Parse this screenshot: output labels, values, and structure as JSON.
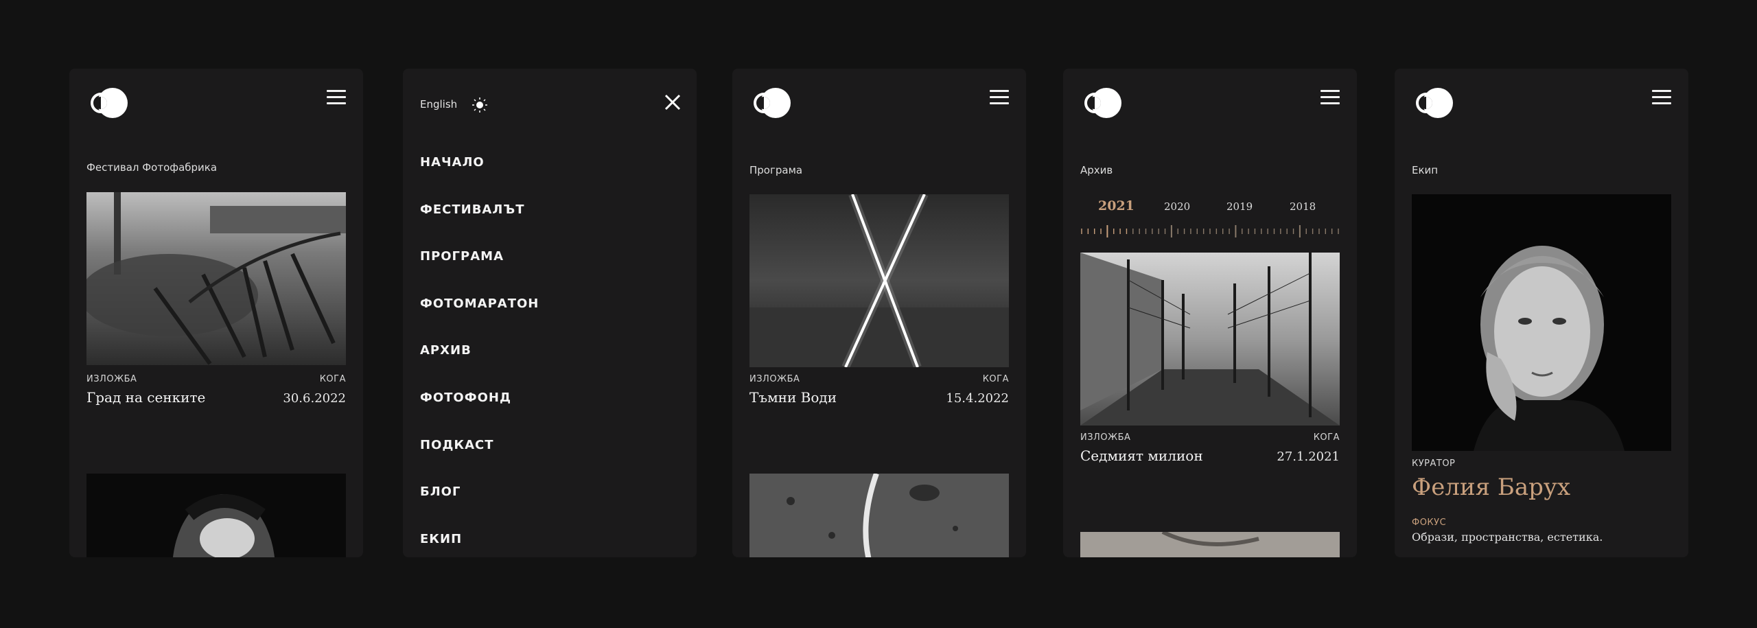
{
  "colors": {
    "background": "#121212",
    "card": "#1b1a1b",
    "accent": "#c9a07d",
    "text": "#f4f4f4"
  },
  "icons": {
    "logo": "two-circles-logo-icon",
    "menu": "hamburger-icon",
    "close": "close-icon",
    "theme": "sun-icon"
  },
  "home": {
    "section": "Фестивал Фотофабрика",
    "card": {
      "kind_label": "ИЗЛОЖБА",
      "when_label": "КОГА",
      "title": "Град на сенките",
      "date": "30.6.2022"
    }
  },
  "menu": {
    "language": "English",
    "items": [
      "НАЧАЛО",
      "ФЕСТИВАЛЪТ",
      "ПРОГРАМА",
      "ФОТОМАРАТОН",
      "АРХИВ",
      "ФОТОФОНД",
      "ПОДКАСТ",
      "БЛОГ",
      "ЕКИП"
    ]
  },
  "program": {
    "section": "Програма",
    "card": {
      "kind_label": "ИЗЛОЖБА",
      "when_label": "КОГА",
      "title": "Тъмни Води",
      "date": "15.4.2022"
    }
  },
  "archive": {
    "section": "Архив",
    "years": [
      "2021",
      "2020",
      "2019",
      "2018"
    ],
    "active_year": "2021",
    "card": {
      "kind_label": "ИЗЛОЖБА",
      "when_label": "КОГА",
      "title": "Седмият милион",
      "date": "27.1.2021"
    }
  },
  "team": {
    "section": "Екип",
    "role": "КУРАТОР",
    "name": "Фелия Барух",
    "focus_label": "ФОКУС",
    "focus": "Образи, пространства, естетика."
  }
}
